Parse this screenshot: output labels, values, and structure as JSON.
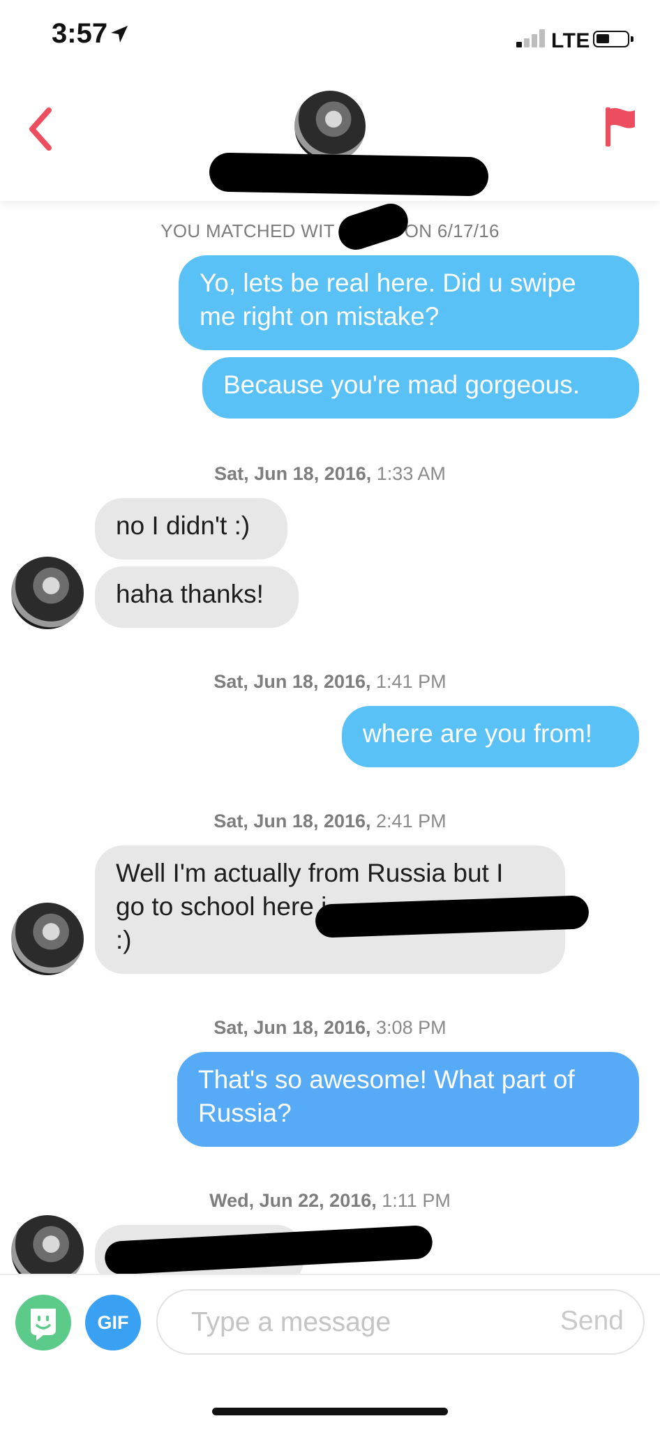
{
  "status_bar": {
    "time": "3:57",
    "network": "LTE"
  },
  "header": {
    "back_icon": "chevron-left-icon",
    "flag_icon": "flag-icon",
    "accent_color": "#ec4d5f"
  },
  "chat": {
    "match_prefix": "YOU MATCHED WIT",
    "match_suffix": "ON 6/17/16",
    "messages": [
      {
        "from": "me",
        "text": "Yo, lets be real here. Did u swipe me right on mistake?"
      },
      {
        "from": "me",
        "text": "Because you're mad gorgeous."
      },
      {
        "date_bold": "Sat, Jun 18, 2016,",
        "date_time": "1:33 AM"
      },
      {
        "from": "them",
        "text": "no I didn't :)"
      },
      {
        "from": "them",
        "text": "haha thanks!"
      },
      {
        "date_bold": "Sat, Jun 18, 2016,",
        "date_time": "1:41 PM"
      },
      {
        "from": "me",
        "text": "where are you from!"
      },
      {
        "date_bold": "Sat, Jun 18, 2016,",
        "date_time": "2:41 PM"
      },
      {
        "from": "them",
        "text_line1": "Well I'm actually from Russia but I",
        "text_line2": "go to school here i",
        "text_line3": ":)"
      },
      {
        "date_bold": "Sat, Jun 18, 2016,",
        "date_time": "3:08 PM"
      },
      {
        "from": "me",
        "text": "That's so awesome! What part of Russia?"
      },
      {
        "date_bold": "Wed, Jun 22, 2016,",
        "date_time": "1:11 PM"
      }
    ]
  },
  "composer": {
    "gif_label": "GIF",
    "placeholder": "Type a message",
    "send_label": "Send",
    "sticker_icon": "sticker-icon"
  },
  "colors": {
    "sent_bubble": "#59c1f5",
    "received_bubble": "#e7e7e7",
    "gif_button": "#3aa0f2",
    "sticker_button": "#5ccb8a"
  }
}
